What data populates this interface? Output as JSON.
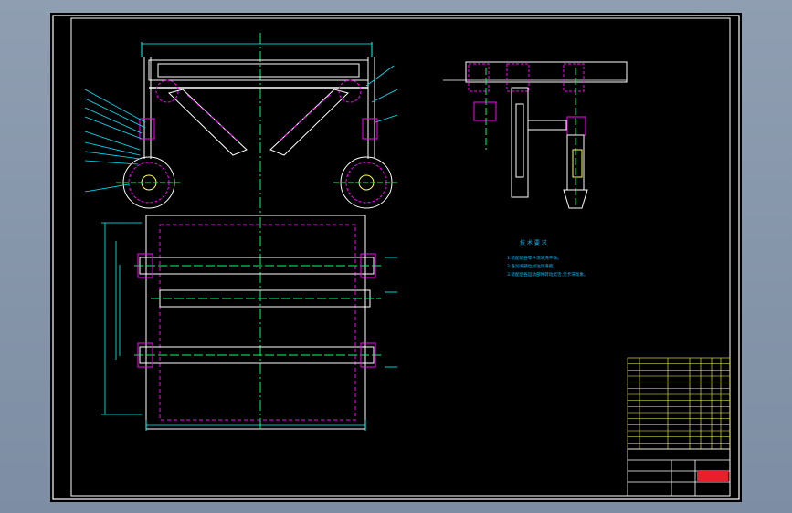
{
  "drawing": {
    "notes_heading": "技 术 要 求",
    "notes": [
      "1.装配前各零件须清洗干净。",
      "2.各润滑部位加注润滑脂。",
      "3.装配后各运动部件转动灵活,无卡滞现象。"
    ],
    "title_block": {
      "stamp": "SEAL"
    }
  },
  "colors": {
    "frame": "#ffffff",
    "part_line": "#ffffff",
    "hidden": "#ff00ff",
    "center": "#00ff66",
    "dimension": "#00ffff",
    "leader": "#00e5ff",
    "note_text": "#00bfff",
    "table_line": "#ffff55",
    "stamp": "#e8202a"
  }
}
